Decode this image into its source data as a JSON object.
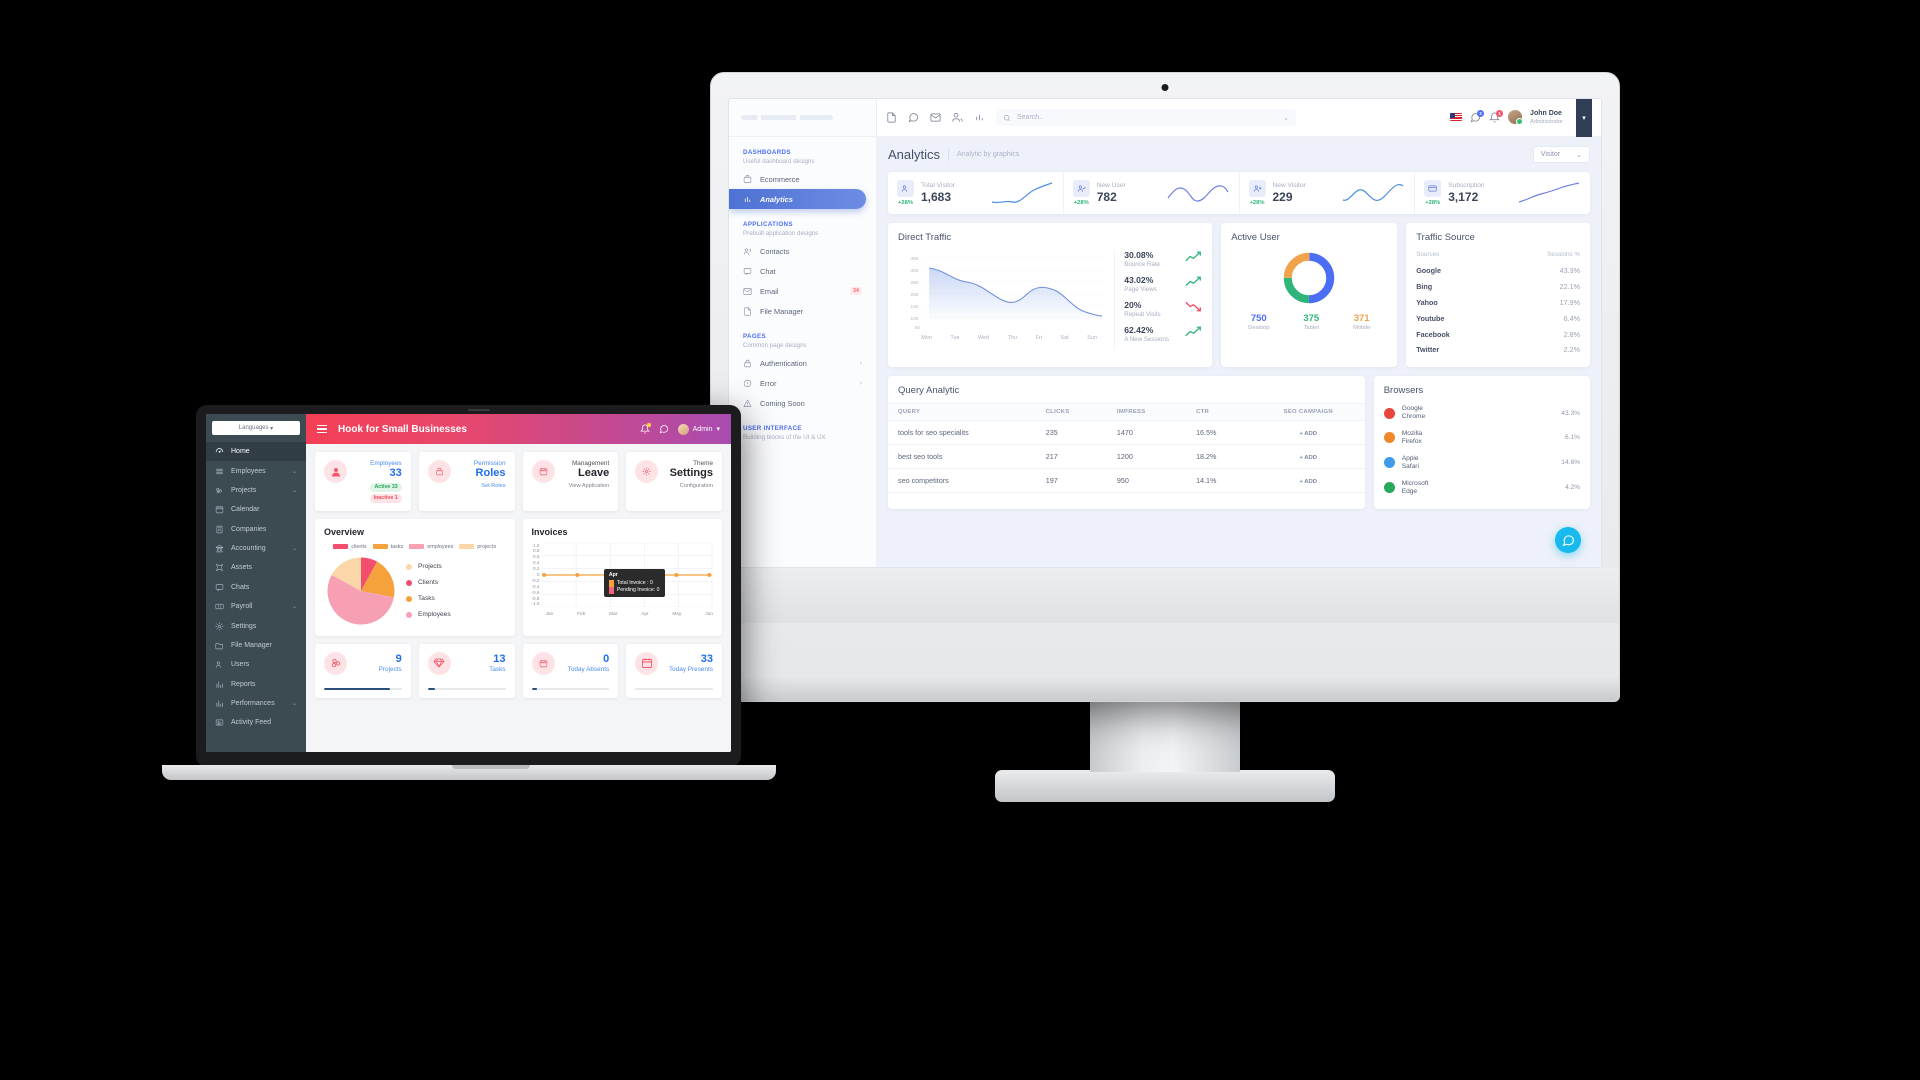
{
  "monitor": {
    "topbar": {
      "icons": [
        "file-icon",
        "chat-icon",
        "mail-icon",
        "contacts-icon",
        "chart-icon"
      ],
      "search_placeholder": "Search..",
      "chat_badge": "2",
      "bell_badge": "1",
      "user_name": "John Doe",
      "user_role": "Administrator"
    },
    "sidebar": {
      "sections": [
        {
          "title": "DASHBOARDS",
          "subtitle": "Useful dashboard designs",
          "items": [
            {
              "label": "Ecommerce",
              "icon": "bag-icon",
              "active": false,
              "badge": null,
              "chevron": false
            },
            {
              "label": "Analytics",
              "icon": "chart-icon",
              "active": true,
              "badge": null,
              "chevron": false
            }
          ]
        },
        {
          "title": "APPLICATIONS",
          "subtitle": "Prebuilt application designs",
          "items": [
            {
              "label": "Contacts",
              "icon": "contacts-icon",
              "active": false,
              "badge": null,
              "chevron": false
            },
            {
              "label": "Chat",
              "icon": "chat-icon",
              "active": false,
              "badge": null,
              "chevron": false
            },
            {
              "label": "Email",
              "icon": "mail-icon",
              "active": false,
              "badge": "34",
              "chevron": false
            },
            {
              "label": "File Manager",
              "icon": "file-icon",
              "active": false,
              "badge": null,
              "chevron": false
            }
          ]
        },
        {
          "title": "PAGES",
          "subtitle": "Common page designs",
          "items": [
            {
              "label": "Authentication",
              "icon": "lock-icon",
              "active": false,
              "badge": null,
              "chevron": true
            },
            {
              "label": "Error",
              "icon": "alert-circle-icon",
              "active": false,
              "badge": null,
              "chevron": true
            },
            {
              "label": "Coming Soon",
              "icon": "warning-triangle-icon",
              "active": false,
              "badge": null,
              "chevron": false
            }
          ]
        },
        {
          "title": "USER INTERFACE",
          "subtitle": "Building blocks of the UI & UX",
          "items": []
        }
      ]
    },
    "page": {
      "title": "Analytics",
      "subtitle": "Analytic by graphics",
      "filter": "Visitor"
    },
    "stats": [
      {
        "label": "Total Visitor",
        "value": "1,683",
        "delta": "+28%",
        "icon": "users-icon"
      },
      {
        "label": "New User",
        "value": "782",
        "delta": "+28%",
        "icon": "user-check-icon"
      },
      {
        "label": "New Visitor",
        "value": "229",
        "delta": "+28%",
        "icon": "user-plus-icon"
      },
      {
        "label": "Subscription",
        "value": "3,172",
        "delta": "+28%",
        "icon": "card-icon"
      }
    ],
    "direct_traffic": {
      "title": "Direct Traffic",
      "stats": [
        {
          "value": "30.08%",
          "label": "Bounce Rate",
          "trend": "up"
        },
        {
          "value": "43.02%",
          "label": "Page Views",
          "trend": "up"
        },
        {
          "value": "20%",
          "label": "Repeat Visits",
          "trend": "down"
        },
        {
          "value": "62.42%",
          "label": "A New Sessions",
          "trend": "up"
        }
      ]
    },
    "active_user": {
      "title": "Active User",
      "nums": [
        {
          "value": "750",
          "label": "Desktop",
          "color": "#4c6ef5"
        },
        {
          "value": "375",
          "label": "Tablet",
          "color": "#2fb57a"
        },
        {
          "value": "371",
          "label": "Mobile",
          "color": "#f0a34a"
        }
      ]
    },
    "traffic_source": {
      "title": "Traffic Source",
      "col_name": "Sources",
      "col_value": "Sessions %",
      "rows": [
        {
          "name": "Google",
          "value": "43.3%"
        },
        {
          "name": "Bing",
          "value": "22.1%"
        },
        {
          "name": "Yahoo",
          "value": "17.9%"
        },
        {
          "name": "Youtube",
          "value": "6.4%"
        },
        {
          "name": "Facebook",
          "value": "2.8%"
        },
        {
          "name": "Twitter",
          "value": "2.2%"
        }
      ]
    },
    "query_analytic": {
      "title": "Query Analytic",
      "columns": [
        "QUERY",
        "CLICKS",
        "IMPRESS",
        "CTR",
        "SEO CAMPAIGN"
      ],
      "rows": [
        {
          "query": "tools for seo specialits",
          "clicks": "235",
          "impress": "1470",
          "ctr": "16.5%",
          "action": "+ ADD"
        },
        {
          "query": "best seo tools",
          "clicks": "217",
          "impress": "1200",
          "ctr": "18.2%",
          "action": "+ ADD"
        },
        {
          "query": "seo competitors",
          "clicks": "197",
          "impress": "950",
          "ctr": "14.1%",
          "action": "+ ADD"
        }
      ]
    },
    "browsers": {
      "title": "Browsers",
      "rows": [
        {
          "name": "Google Chrome",
          "value": "43.3%",
          "color": "#e8453c"
        },
        {
          "name": "Mozilla Firefox",
          "value": "6.1%",
          "color": "#f0882b"
        },
        {
          "name": "Apple Safari",
          "value": "14.6%",
          "color": "#3e9bea"
        },
        {
          "name": "Microsoft Edge",
          "value": "4.2%",
          "color": "#2aa85a"
        }
      ]
    },
    "chat_button_icon": "chat-bubble-icon"
  },
  "laptop": {
    "header": {
      "title": "Hook for Small Businesses",
      "admin_label": "Admin"
    },
    "sidebar": {
      "language_selector": "Languages",
      "items": [
        {
          "label": "Home",
          "icon": "dashboard-icon",
          "active": true,
          "chevron": false
        },
        {
          "label": "Employees",
          "icon": "list-icon",
          "active": false,
          "chevron": true
        },
        {
          "label": "Projects",
          "icon": "project-icon",
          "active": false,
          "chevron": true
        },
        {
          "label": "Calendar",
          "icon": "calendar-icon",
          "active": false,
          "chevron": false
        },
        {
          "label": "Companies",
          "icon": "building-icon",
          "active": false,
          "chevron": false
        },
        {
          "label": "Accounting",
          "icon": "bank-icon",
          "active": false,
          "chevron": true
        },
        {
          "label": "Assets",
          "icon": "assets-icon",
          "active": false,
          "chevron": false
        },
        {
          "label": "Chats",
          "icon": "chat-icon",
          "active": false,
          "chevron": false
        },
        {
          "label": "Payroll",
          "icon": "money-icon",
          "active": false,
          "chevron": true
        },
        {
          "label": "Settings",
          "icon": "gear-icon",
          "active": false,
          "chevron": false
        },
        {
          "label": "File Manager",
          "icon": "folder-icon",
          "active": false,
          "chevron": false
        },
        {
          "label": "Users",
          "icon": "users-icon",
          "active": false,
          "chevron": false
        },
        {
          "label": "Reports",
          "icon": "bar-chart-icon",
          "active": false,
          "chevron": false
        },
        {
          "label": "Performances",
          "icon": "bar-chart-icon",
          "active": false,
          "chevron": true
        },
        {
          "label": "Activity Feed",
          "icon": "feed-icon",
          "active": false,
          "chevron": false
        }
      ]
    },
    "top_cards": [
      {
        "label": "Employees",
        "value": "33",
        "sub": null,
        "icon": "user-icon",
        "pills": [
          {
            "text": "Active 33",
            "kind": "g"
          },
          {
            "text": "Inactive 1",
            "kind": "r"
          }
        ],
        "dark": false
      },
      {
        "label": "Permission",
        "value": "Roles",
        "sub": "Set Roles",
        "icon": "lock-icon",
        "pills": [],
        "dark": false
      },
      {
        "label": "Management",
        "value": "Leave",
        "sub": "View Application",
        "icon": "calendar-icon",
        "pills": [],
        "dark": true
      },
      {
        "label": "Theme",
        "value": "Settings",
        "sub": "Configuration",
        "icon": "gear-icon",
        "pills": [],
        "dark": true
      }
    ],
    "bottom_cards": [
      {
        "value": "9",
        "label": "Projects",
        "icon": "cubes-icon",
        "progress": 85
      },
      {
        "value": "13",
        "label": "Tasks",
        "icon": "diamond-icon",
        "progress": 9
      },
      {
        "value": "0",
        "label": "Today Absents",
        "icon": "calendar-icon",
        "progress": 7
      },
      {
        "value": "33",
        "label": "Today Presents",
        "icon": "calendar-check-icon",
        "progress": 0
      }
    ],
    "chart_data": [
      {
        "type": "pie",
        "title": "Overview",
        "legend_top": [
          {
            "label": "clients",
            "color": "#f24f6e"
          },
          {
            "label": "tasks",
            "color": "#f5a23c"
          },
          {
            "label": "employees",
            "color": "#f7a0b3"
          },
          {
            "label": "projects",
            "color": "#fbd6a8"
          }
        ],
        "legend_right": [
          {
            "label": "Projects",
            "color": "#fbd6a8"
          },
          {
            "label": "Clients",
            "color": "#f24f6e"
          },
          {
            "label": "Tasks",
            "color": "#f5a23c"
          },
          {
            "label": "Employees",
            "color": "#f7a0b3"
          }
        ],
        "categories": [
          "Clients",
          "Tasks",
          "Employees",
          "Projects"
        ],
        "values": [
          8,
          20,
          55,
          17
        ],
        "legend_position": "right"
      },
      {
        "type": "line",
        "title": "Invoices",
        "x": [
          "Jan",
          "Feb",
          "Mar",
          "Apr",
          "May",
          "Jun"
        ],
        "ylim": [
          -1.0,
          1.0
        ],
        "yticks": [
          "1.0",
          "0.8",
          "0.6",
          "0.4",
          "0.2",
          "0",
          "-0.2",
          "-0.4",
          "-0.6",
          "-0.8",
          "-1.0"
        ],
        "grid": true,
        "series": [
          {
            "name": "Total Invoice",
            "values": [
              0,
              0,
              0,
              0,
              0,
              0
            ],
            "color": "#f5a23c"
          },
          {
            "name": "Pending Invoice",
            "values": [
              0,
              0,
              0,
              0,
              0,
              0
            ],
            "color": "#f4637f"
          }
        ],
        "tooltip": {
          "title": "Apr",
          "rows": [
            {
              "label": "Total Invoice : 0",
              "color": "#f5a23c"
            },
            {
              "label": "Pending Invoice: 0",
              "color": "#f4637f"
            }
          ]
        }
      }
    ]
  },
  "colors": {
    "accent_blue": "#4c6ef5",
    "accent_red": "#f4566a",
    "green": "#2fb57a",
    "orange": "#f0a34a"
  }
}
